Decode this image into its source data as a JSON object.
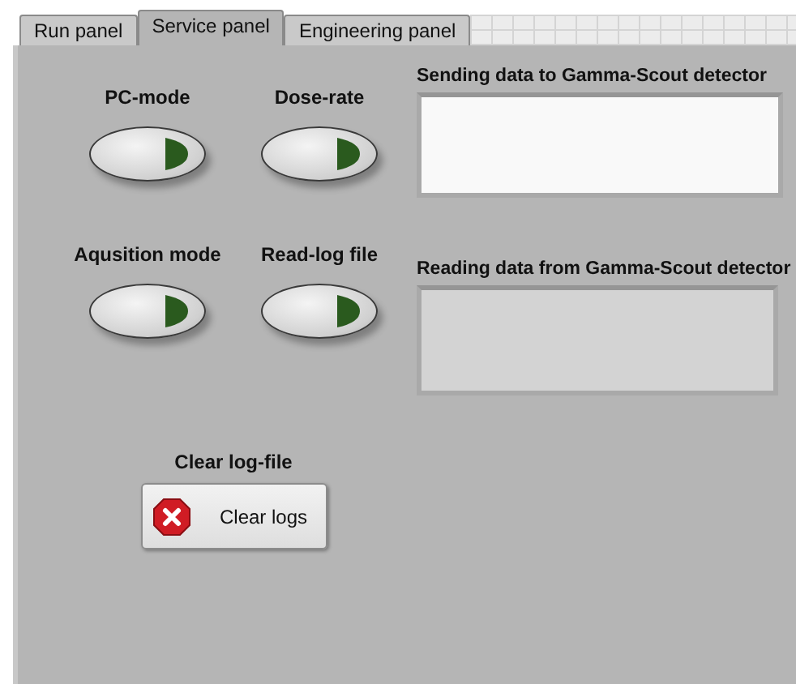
{
  "tabs": [
    {
      "label": "Run panel",
      "selected": false
    },
    {
      "label": "Service panel",
      "selected": true
    },
    {
      "label": "Engineering panel",
      "selected": false
    }
  ],
  "mode_buttons": [
    {
      "label": "PC-mode",
      "on": false
    },
    {
      "label": "Dose-rate",
      "on": false
    },
    {
      "label": "Aqusition mode",
      "on": false
    },
    {
      "label": "Read-log file",
      "on": false
    }
  ],
  "clear_section": {
    "label": "Clear log-file",
    "button": "Clear logs"
  },
  "sending": {
    "label": "Sending data to Gamma-Scout detector",
    "disabled": false
  },
  "reading": {
    "label": "Reading data from Gamma-Scout detector",
    "disabled": true
  }
}
